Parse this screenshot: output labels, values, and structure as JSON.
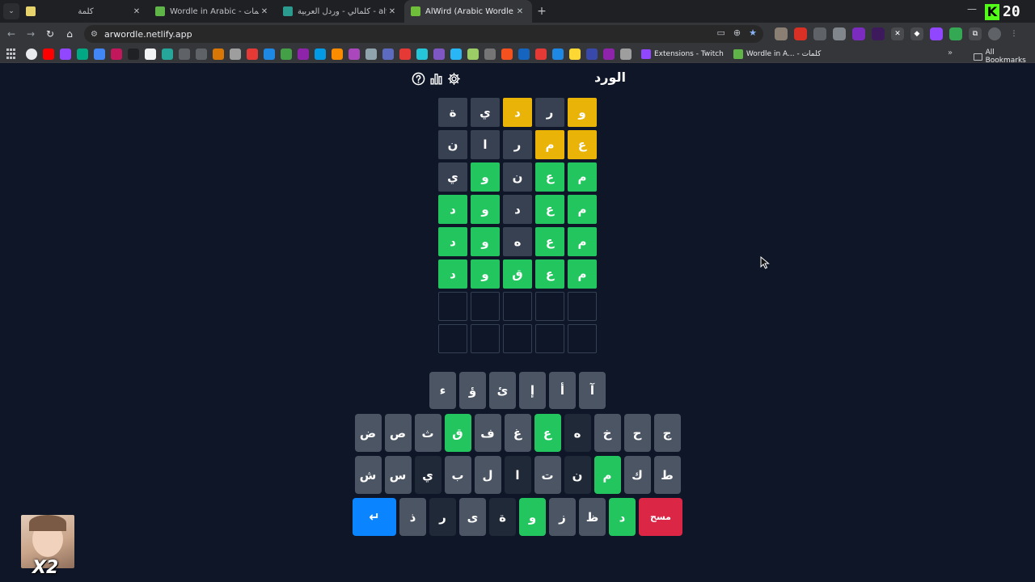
{
  "browser": {
    "tabs": [
      {
        "title": "كلمة",
        "favicon_color": "#e6d36b",
        "active": false
      },
      {
        "title": "Wordle in Arabic - كلمات",
        "favicon_color": "#5fb548",
        "active": false
      },
      {
        "title": "كلمالي - وردل العربية - aly.com",
        "favicon_color": "#2b9b8f",
        "active": false
      },
      {
        "title": "AlWird (Arabic Wordle) - الورد",
        "favicon_color": "#6fbf3a",
        "active": true
      }
    ],
    "close_glyph": "✕",
    "new_tab_glyph": "+",
    "address": "arwordle.netlify.app",
    "corner_number": "20",
    "corner_letter": "K",
    "bookmarks": [
      {
        "label": "Extensions - Twitch",
        "color": "#9146ff"
      },
      {
        "label": "Wordle in A... - كلمات",
        "color": "#5fb548"
      }
    ],
    "all_bookmarks": "All Bookmarks"
  },
  "game": {
    "title": "الورد",
    "board": [
      [
        {
          "l": "و",
          "s": "present"
        },
        {
          "l": "ر",
          "s": "absent"
        },
        {
          "l": "د",
          "s": "present"
        },
        {
          "l": "ي",
          "s": "absent"
        },
        {
          "l": "ة",
          "s": "absent"
        }
      ],
      [
        {
          "l": "ع",
          "s": "present"
        },
        {
          "l": "م",
          "s": "present"
        },
        {
          "l": "ر",
          "s": "absent"
        },
        {
          "l": "ا",
          "s": "absent"
        },
        {
          "l": "ن",
          "s": "absent"
        }
      ],
      [
        {
          "l": "م",
          "s": "correct"
        },
        {
          "l": "ع",
          "s": "correct"
        },
        {
          "l": "ن",
          "s": "absent"
        },
        {
          "l": "و",
          "s": "correct"
        },
        {
          "l": "ي",
          "s": "absent"
        }
      ],
      [
        {
          "l": "م",
          "s": "correct"
        },
        {
          "l": "ع",
          "s": "correct"
        },
        {
          "l": "د",
          "s": "absent"
        },
        {
          "l": "و",
          "s": "correct"
        },
        {
          "l": "د",
          "s": "correct"
        }
      ],
      [
        {
          "l": "م",
          "s": "correct"
        },
        {
          "l": "ع",
          "s": "correct"
        },
        {
          "l": "ه",
          "s": "absent"
        },
        {
          "l": "و",
          "s": "correct"
        },
        {
          "l": "د",
          "s": "correct"
        }
      ],
      [
        {
          "l": "م",
          "s": "correct"
        },
        {
          "l": "ع",
          "s": "correct"
        },
        {
          "l": "ق",
          "s": "correct"
        },
        {
          "l": "و",
          "s": "correct"
        },
        {
          "l": "د",
          "s": "correct"
        }
      ],
      [
        {
          "l": "",
          "s": "empty"
        },
        {
          "l": "",
          "s": "empty"
        },
        {
          "l": "",
          "s": "empty"
        },
        {
          "l": "",
          "s": "empty"
        },
        {
          "l": "",
          "s": "empty"
        }
      ],
      [
        {
          "l": "",
          "s": "empty"
        },
        {
          "l": "",
          "s": "empty"
        },
        {
          "l": "",
          "s": "empty"
        },
        {
          "l": "",
          "s": "empty"
        },
        {
          "l": "",
          "s": "empty"
        }
      ]
    ],
    "keyboard": [
      [
        {
          "k": "آ"
        },
        {
          "k": "أ"
        },
        {
          "k": "إ"
        },
        {
          "k": "ئ"
        },
        {
          "k": "ؤ"
        },
        {
          "k": "ء"
        }
      ],
      [
        {
          "k": "ج"
        },
        {
          "k": "ح"
        },
        {
          "k": "خ"
        },
        {
          "k": "ه",
          "s": "dark"
        },
        {
          "k": "ع",
          "s": "correct"
        },
        {
          "k": "غ"
        },
        {
          "k": "ف"
        },
        {
          "k": "ق",
          "s": "correct"
        },
        {
          "k": "ث"
        },
        {
          "k": "ص"
        },
        {
          "k": "ض"
        }
      ],
      [
        {
          "k": "ط"
        },
        {
          "k": "ك"
        },
        {
          "k": "م",
          "s": "correct"
        },
        {
          "k": "ن",
          "s": "dark"
        },
        {
          "k": "ت"
        },
        {
          "k": "ا",
          "s": "dark"
        },
        {
          "k": "ل"
        },
        {
          "k": "ب"
        },
        {
          "k": "ي",
          "s": "dark"
        },
        {
          "k": "س"
        },
        {
          "k": "ش"
        }
      ],
      [
        {
          "k": "مسح",
          "s": "delete"
        },
        {
          "k": "د",
          "s": "correct"
        },
        {
          "k": "ظ"
        },
        {
          "k": "ز"
        },
        {
          "k": "و",
          "s": "correct"
        },
        {
          "k": "ة",
          "s": "dark"
        },
        {
          "k": "ى"
        },
        {
          "k": "ر",
          "s": "dark"
        },
        {
          "k": "ذ"
        },
        {
          "k": "↵",
          "s": "enter"
        }
      ]
    ]
  },
  "overlay": {
    "badge": "X2"
  }
}
